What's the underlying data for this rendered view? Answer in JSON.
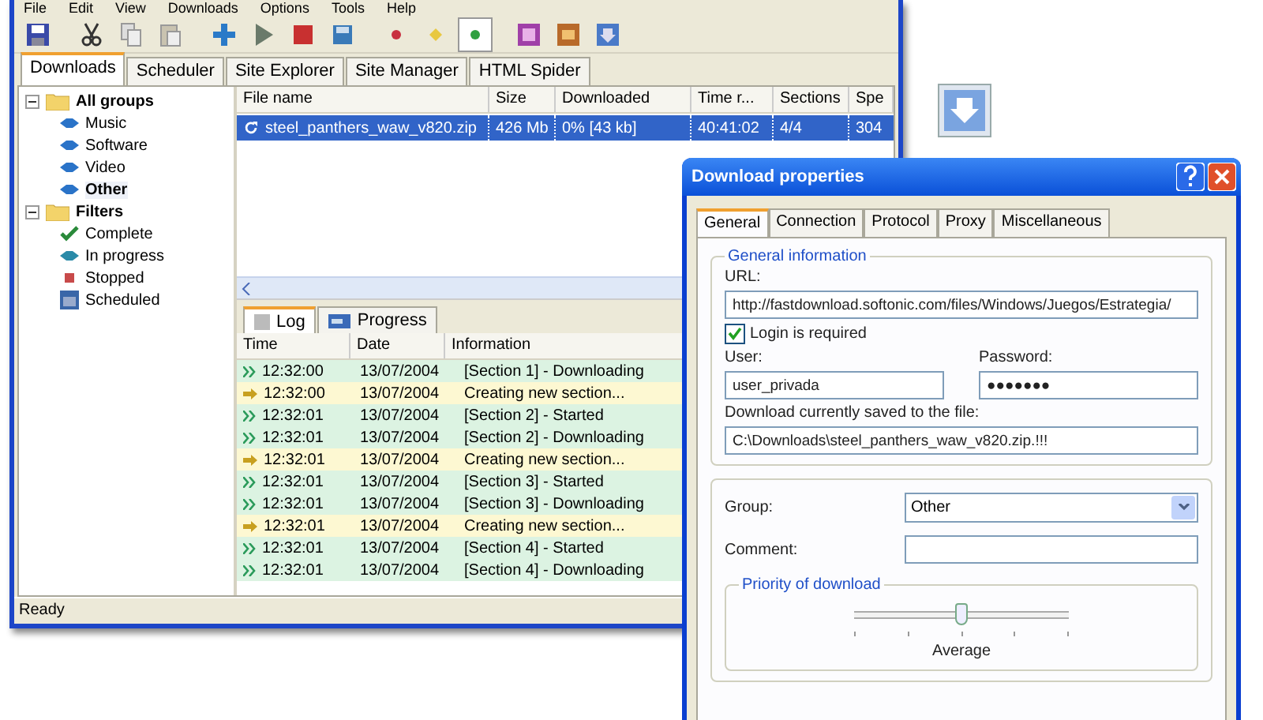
{
  "main_window": {
    "menu": [
      "File",
      "Edit",
      "View",
      "Downloads",
      "Options",
      "Tools",
      "Help"
    ],
    "tabs": [
      {
        "label": "Downloads",
        "selected": true
      },
      {
        "label": "Scheduler",
        "selected": false
      },
      {
        "label": "Site Explorer",
        "selected": false
      },
      {
        "label": "Site Manager",
        "selected": false
      },
      {
        "label": "HTML Spider",
        "selected": false
      }
    ],
    "sidebar": {
      "items": [
        {
          "label": "All groups",
          "kind": "folder",
          "expanded": true,
          "selected": false,
          "children": [
            {
              "label": "Music",
              "kind": "group",
              "selected": false
            },
            {
              "label": "Software",
              "kind": "group",
              "selected": false
            },
            {
              "label": "Video",
              "kind": "group",
              "selected": false
            },
            {
              "label": "Other",
              "kind": "group",
              "selected": true
            }
          ]
        },
        {
          "label": "Filters",
          "kind": "folder",
          "expanded": true,
          "selected": false,
          "children": [
            {
              "label": "Complete",
              "kind": "complete",
              "selected": false
            },
            {
              "label": "In progress",
              "kind": "progress",
              "selected": false
            },
            {
              "label": "Stopped",
              "kind": "stopped",
              "selected": false
            },
            {
              "label": "Scheduled",
              "kind": "scheduled",
              "selected": false
            }
          ]
        }
      ]
    },
    "file_list": {
      "columns": [
        "File name",
        "Size",
        "Downloaded",
        "Time r...",
        "Sections",
        "Spe"
      ],
      "rows": [
        {
          "selected": true,
          "cells": [
            "steel_panthers_waw_v820.zip",
            "426 Mb",
            "0% [43 kb]",
            "40:41:02",
            "4/4",
            "304"
          ]
        }
      ]
    },
    "log_tabs": [
      {
        "label": "Log",
        "selected": true
      },
      {
        "label": "Progress",
        "selected": false
      }
    ],
    "log": {
      "columns": [
        "Time",
        "Date",
        "Information"
      ],
      "rows": [
        {
          "kind": "info",
          "time": "12:32:00",
          "date": "13/07/2004",
          "information": "[Section 1] - Downloading"
        },
        {
          "kind": "action",
          "time": "12:32:00",
          "date": "13/07/2004",
          "information": "Creating new section..."
        },
        {
          "kind": "info",
          "time": "12:32:01",
          "date": "13/07/2004",
          "information": "[Section 2] - Started"
        },
        {
          "kind": "info",
          "time": "12:32:01",
          "date": "13/07/2004",
          "information": "[Section 2] - Downloading"
        },
        {
          "kind": "action",
          "time": "12:32:01",
          "date": "13/07/2004",
          "information": "Creating new section..."
        },
        {
          "kind": "info",
          "time": "12:32:01",
          "date": "13/07/2004",
          "information": "[Section 3] - Started"
        },
        {
          "kind": "info",
          "time": "12:32:01",
          "date": "13/07/2004",
          "information": "[Section 3] - Downloading"
        },
        {
          "kind": "action",
          "time": "12:32:01",
          "date": "13/07/2004",
          "information": "Creating new section..."
        },
        {
          "kind": "info",
          "time": "12:32:01",
          "date": "13/07/2004",
          "information": "[Section 4] - Started"
        },
        {
          "kind": "info",
          "time": "12:32:01",
          "date": "13/07/2004",
          "information": "[Section 4] - Downloading"
        }
      ]
    },
    "status_bar": "Ready"
  },
  "dialog": {
    "title": "Download properties",
    "tabs": [
      {
        "label": "General",
        "selected": true
      },
      {
        "label": "Connection",
        "selected": false
      },
      {
        "label": "Protocol",
        "selected": false
      },
      {
        "label": "Proxy",
        "selected": false
      },
      {
        "label": "Miscellaneous",
        "selected": false
      }
    ],
    "general_information": {
      "title": "General information",
      "url_label": "URL:",
      "url": "http://fastdownload.softonic.com/files/Windows/Juegos/Estrategia/",
      "login_required": {
        "label": "Login is required",
        "checked": true
      },
      "user_label": "User:",
      "user": "user_privada",
      "password_label": "Password:",
      "password": "●●●●●●●",
      "file_label": "Download currently saved to the file:",
      "file": "C:\\Downloads\\steel_panthers_waw_v820.zip.!!!"
    },
    "group_label": "Group:",
    "group": "Other",
    "comment_label": "Comment:",
    "priority": {
      "title": "Priority of download",
      "level": 0.5,
      "reading": "Average"
    }
  }
}
